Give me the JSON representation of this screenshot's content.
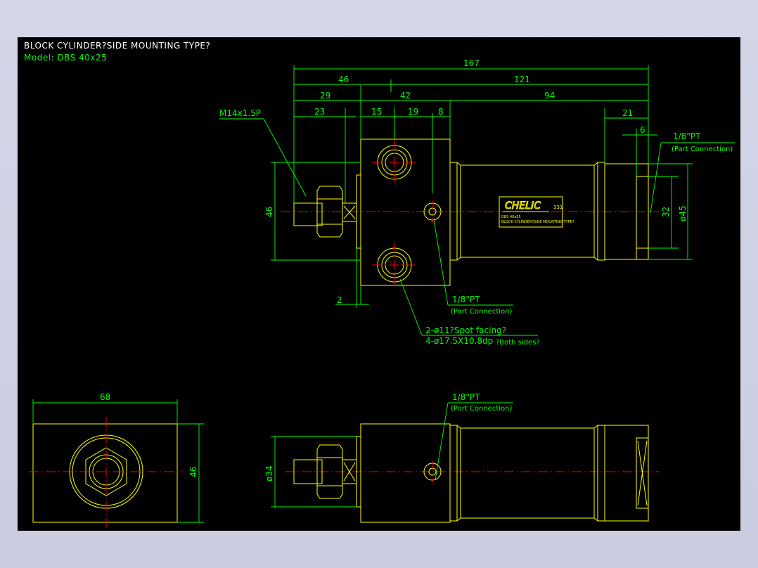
{
  "drawing": {
    "title": "BLOCK CYLINDER?SIDE MOUNTING TYPE?",
    "model": "Model: DBS 40x25"
  },
  "dimensions": {
    "d167": "167",
    "d46_top": "46",
    "d121": "121",
    "d29": "29",
    "d42": "42",
    "d94": "94",
    "d23": "23",
    "d15": "15",
    "d19": "19",
    "d8": "8",
    "d21": "21",
    "d6": "6",
    "d46_left": "46",
    "d2": "2",
    "d32": "32",
    "dia45": "ø45",
    "d68": "68",
    "d46_end": "46",
    "dia34": "ø34"
  },
  "notes": {
    "thread": "M14x1.5P",
    "port_pt_right": "1/8\"PT",
    "port_conn_right": "(Part Connection)",
    "port_pt_mid": "1/8\"PT",
    "port_conn_mid": "(Port Connection)",
    "spot_facing": "2-ø11?Spot facing?",
    "counterbore": "4-ø17.5X10.8dp",
    "both_sides": "?Both sides?",
    "port_pt_bottom": "1/8\"PT",
    "port_conn_bottom": "(Port Connection)"
  },
  "label_plate": {
    "brand": "CHELIC",
    "code": "331",
    "line1": "DBS 40x25",
    "line2": "BLOCK CYLINDER?SIDE MOUNTING TYPE?"
  },
  "colors": {
    "background": "#000000",
    "outline": "#ffff00",
    "dimension": "#00ff00",
    "centerline": "#ff0000",
    "frame": "#d4d6e8"
  }
}
